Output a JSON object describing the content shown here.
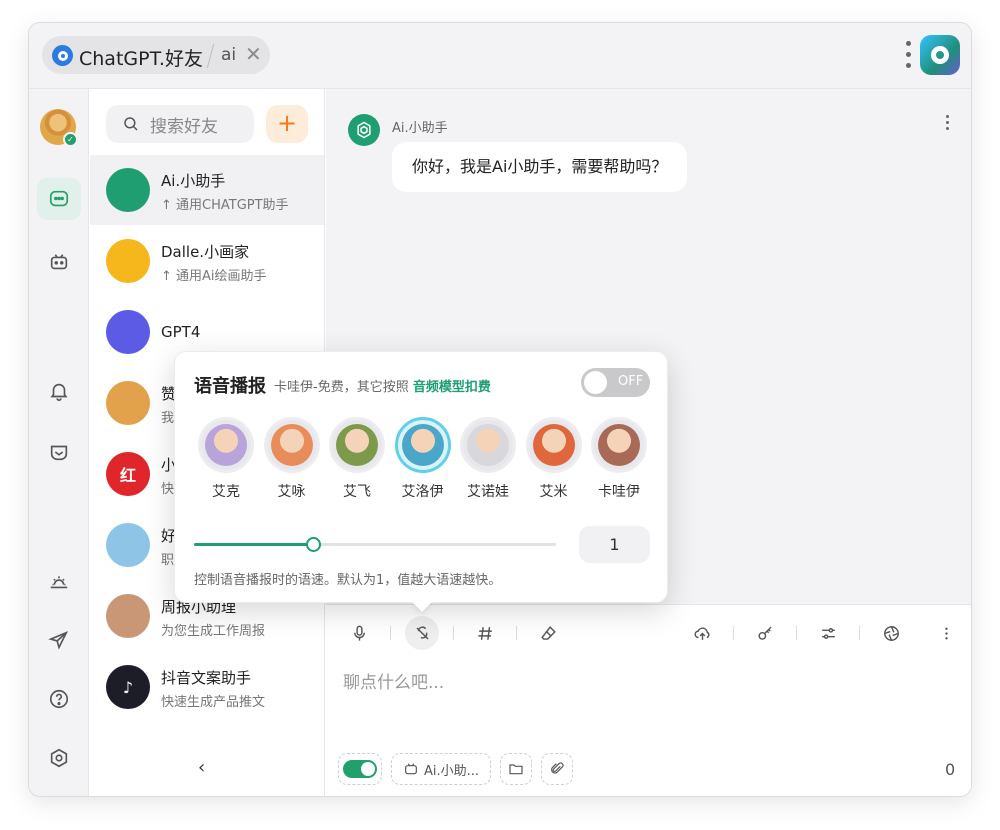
{
  "titlebar": {
    "tab_title": "ChatGPT.好友",
    "tab_secondary": "ai",
    "close_glyph": "✕",
    "icons": [
      "chatgpt-tab-icon",
      "kebab-icon",
      "app-logo-icon"
    ]
  },
  "leftbar": {
    "items": [
      {
        "name": "chat",
        "icon": "chat-bubble-icon",
        "active": true
      },
      {
        "name": "bots",
        "icon": "robot-icon",
        "active": false
      },
      {
        "name": "notifications",
        "icon": "bell-icon",
        "active": false
      },
      {
        "name": "mailbox",
        "icon": "inbox-icon",
        "active": false
      },
      {
        "name": "sunrise",
        "icon": "sunrise-icon",
        "active": false
      },
      {
        "name": "send",
        "icon": "send-icon",
        "active": false
      },
      {
        "name": "help",
        "icon": "help-icon",
        "active": false
      },
      {
        "name": "settings",
        "icon": "hexagon-settings-icon",
        "active": false
      }
    ]
  },
  "contacts": {
    "search_placeholder": "搜索好友",
    "add_glyph": "+",
    "collapse_glyph": "‹",
    "items": [
      {
        "name": "Ai.小助手",
        "desc": "↑ 通用CHATGPT助手",
        "avatar_color": "#1f9e72",
        "avatar_text": ""
      },
      {
        "name": "Dalle.小画家",
        "desc": "↑ 通用Ai绘画助手",
        "avatar_color": "#f5b71b",
        "avatar_text": ""
      },
      {
        "name": "GPT4",
        "desc": "",
        "avatar_color": "#5b5be6",
        "avatar_text": ""
      },
      {
        "name": "赞",
        "desc": "我",
        "avatar_color": "#e2a24c",
        "avatar_text": ""
      },
      {
        "name": "小",
        "desc": "快",
        "avatar_color": "#e0262b",
        "avatar_text": "红"
      },
      {
        "name": "好",
        "desc": "职",
        "avatar_color": "#8ec5e6",
        "avatar_text": ""
      },
      {
        "name": "周报小助理",
        "desc": "为您生成工作周报",
        "avatar_color": "#c99676",
        "avatar_text": ""
      },
      {
        "name": "抖音文案助手",
        "desc": "快速生成产品推文",
        "avatar_color": "#1d1d28",
        "avatar_text": "♪"
      }
    ]
  },
  "chat": {
    "sender": "Ai.小助手",
    "message": "你好，我是Ai小助手，需要帮助吗？"
  },
  "composer": {
    "placeholder": "聊点什么吧...",
    "bot_chip": "Ai.小助...",
    "char_count": "0",
    "toolbar": [
      "microphone-icon",
      "voice-off-icon",
      "hashtag-icon",
      "eraser-icon",
      "cloud-upload-icon",
      "key-icon",
      "sliders-icon",
      "aperture-icon",
      "kebab-icon"
    ]
  },
  "voice_popup": {
    "title": "语音播报",
    "subtitle": "卡哇伊-免费，其它按照",
    "subtitle_link": "音频模型扣费",
    "toggle_label": "OFF",
    "voices": [
      {
        "name": "艾克",
        "color": "#b8a4d8",
        "selected": false
      },
      {
        "name": "艾咏",
        "color": "#e88d5a",
        "selected": false
      },
      {
        "name": "艾飞",
        "color": "#7d9a4a",
        "selected": false
      },
      {
        "name": "艾洛伊",
        "color": "#4aa7c9",
        "selected": true
      },
      {
        "name": "艾诺娃",
        "color": "#d8d8dc",
        "selected": false
      },
      {
        "name": "艾米",
        "color": "#e0673c",
        "selected": false
      },
      {
        "name": "卡哇伊",
        "color": "#a86a56",
        "selected": false
      }
    ],
    "speed_value": "1",
    "speed_fraction": 0.33,
    "hint": "控制语音播报时的语速。默认为1，值越大语速越快。"
  }
}
